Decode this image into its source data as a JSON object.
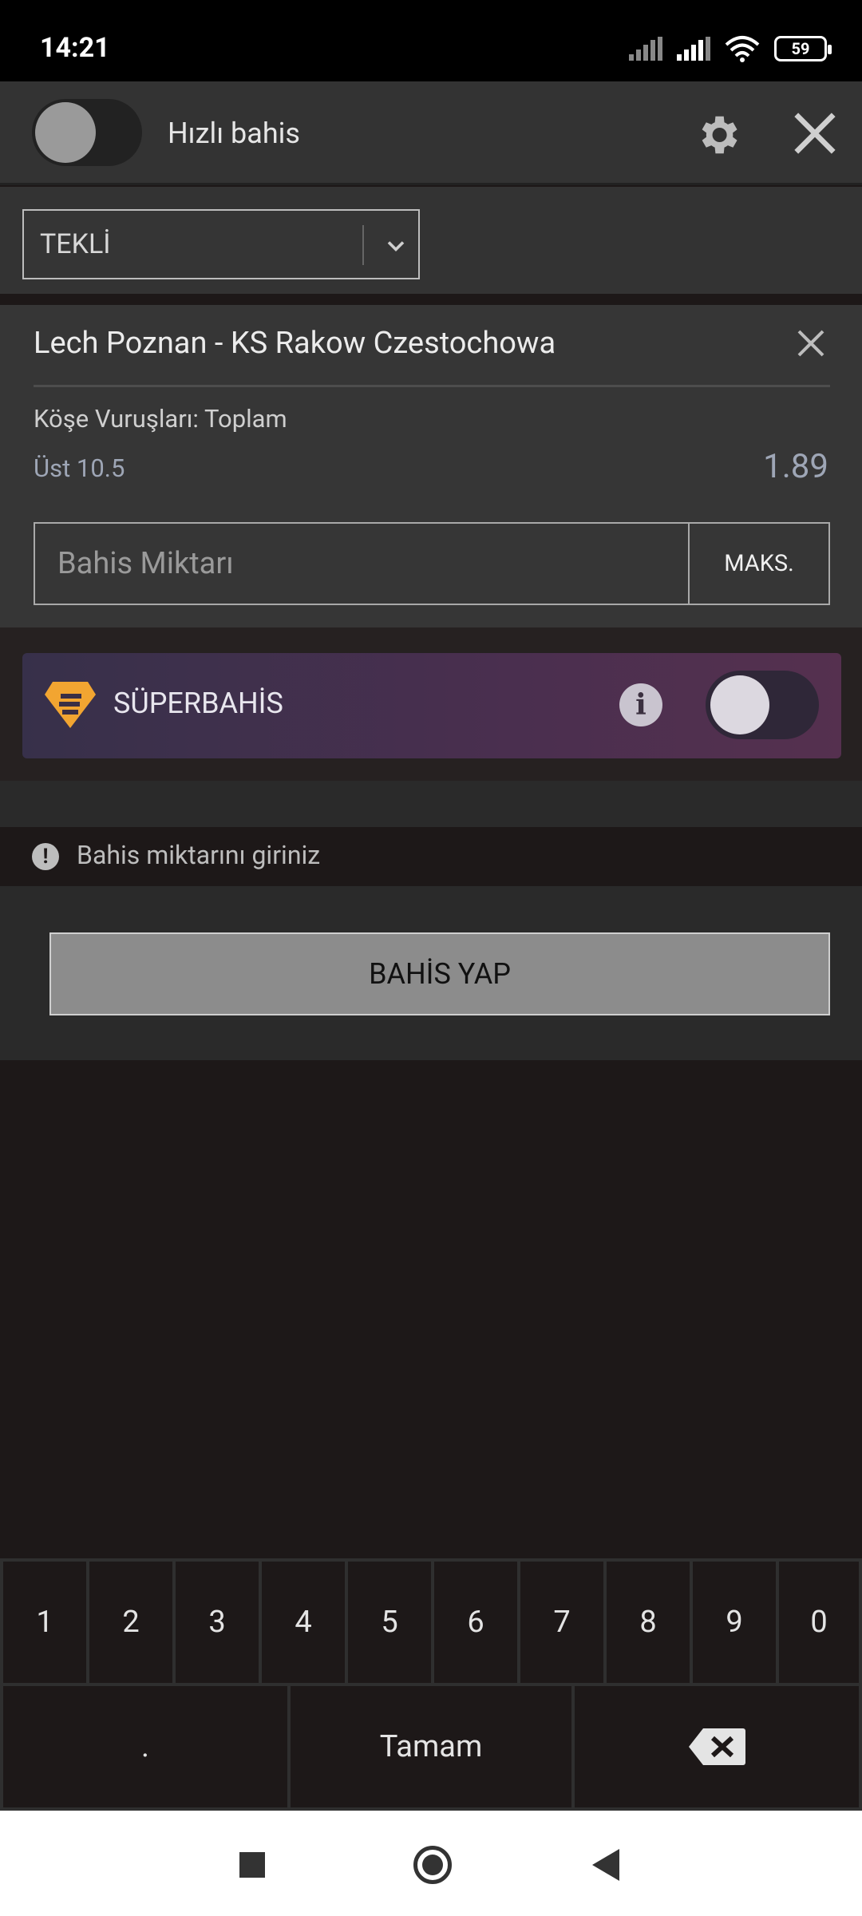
{
  "status_bar": {
    "time": "14:21",
    "battery": "59"
  },
  "header": {
    "quick_bet_label": "Hızlı bahis"
  },
  "bet_type": {
    "selected": "TEKLİ"
  },
  "bet": {
    "match": "Lech Poznan - KS Rakow Czestochowa",
    "market": "Köşe Vuruşları: Toplam",
    "selection": "Üst 10.5",
    "odds": "1.89",
    "stake_placeholder": "Bahis Miktarı",
    "max_label": "MAKS."
  },
  "superbahis": {
    "label": "SÜPERBAHİS",
    "info": "i"
  },
  "warning": {
    "text": "Bahis miktarını giriniz"
  },
  "place_bet": {
    "label": "BAHİS YAP"
  },
  "keyboard": {
    "digits": [
      "1",
      "2",
      "3",
      "4",
      "5",
      "6",
      "7",
      "8",
      "9",
      "0"
    ],
    "dot": ".",
    "done": "Tamam"
  }
}
